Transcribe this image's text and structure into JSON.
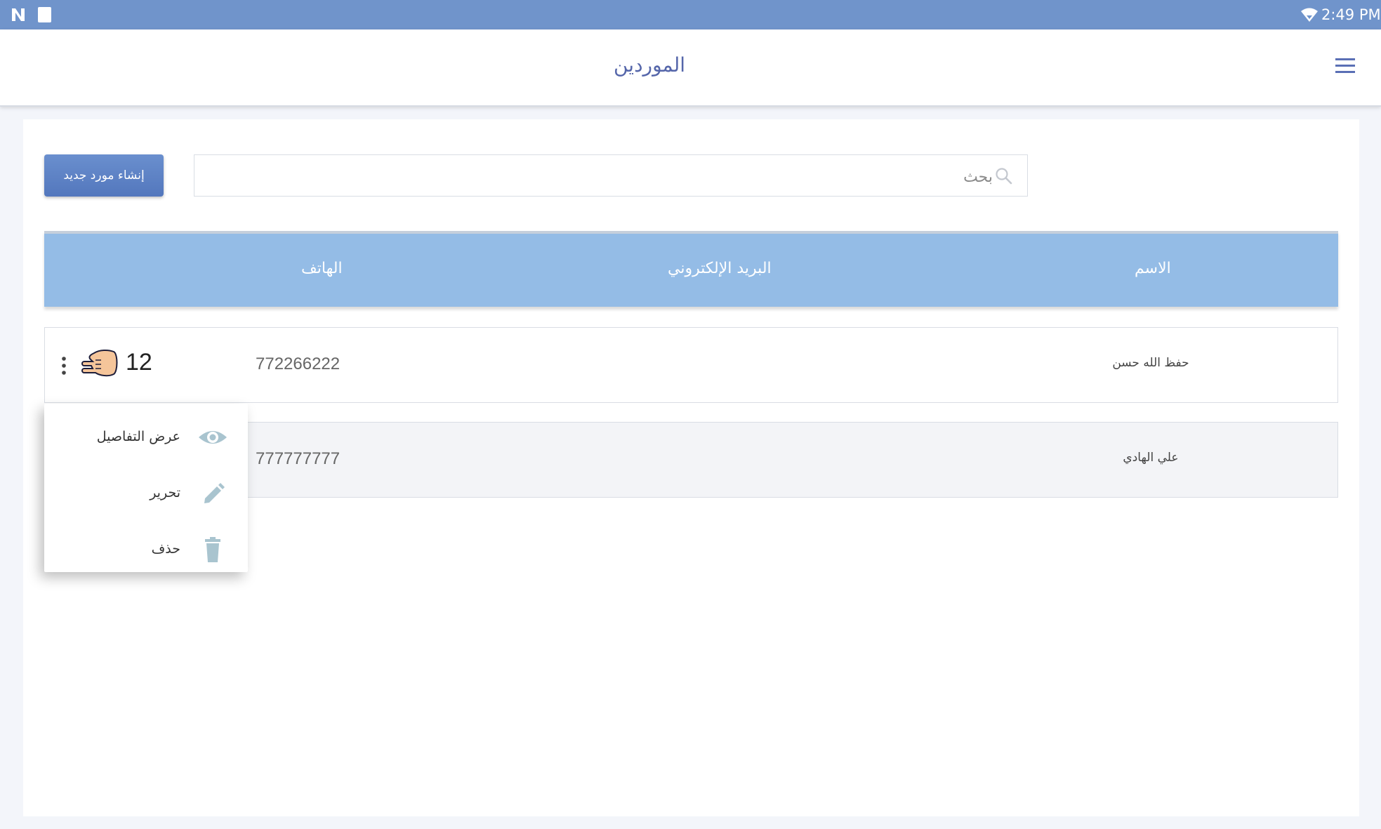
{
  "status_bar": {
    "time": "2:49 PM",
    "icons": [
      "n-icon",
      "sd-card-icon",
      "wifi-icon"
    ]
  },
  "app_bar": {
    "title": "الموردين",
    "menu_icon": "hamburger-menu-icon"
  },
  "toolbar": {
    "create_button_label": "إنشاء مورد جديد",
    "search_placeholder": "بحث",
    "search_value": ""
  },
  "table": {
    "columns": [
      "الاسم",
      "البريد الإلكتروني",
      "الهاتف"
    ],
    "rows": [
      {
        "name": "حفظ الله حسن",
        "email": "",
        "phone": "772266222",
        "count": "12"
      },
      {
        "name": "علي الهادي",
        "email": "",
        "phone": "777777777"
      }
    ]
  },
  "row_menu": {
    "items": [
      {
        "label": "عرض التفاصيل",
        "icon": "eye-icon"
      },
      {
        "label": "تحرير",
        "icon": "pencil-icon"
      },
      {
        "label": "حذف",
        "icon": "trash-icon"
      }
    ]
  },
  "colors": {
    "status_bar": "#7094cb",
    "table_header": "#94bce6",
    "primary_button": "#5a7fc4",
    "title": "#5566aa",
    "menu_icon_tint": "#a9c4cf"
  }
}
